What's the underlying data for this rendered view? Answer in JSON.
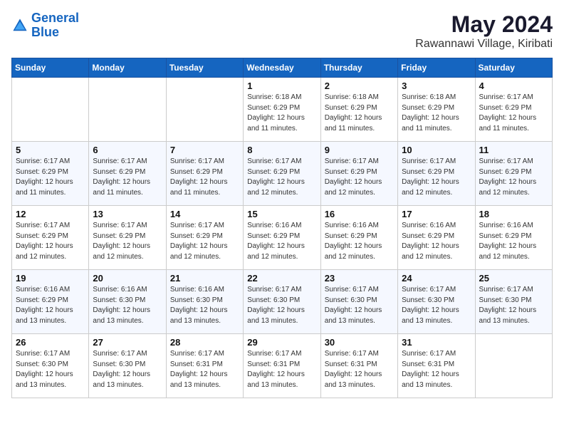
{
  "header": {
    "logo_line1": "General",
    "logo_line2": "Blue",
    "month": "May 2024",
    "location": "Rawannawi Village, Kiribati"
  },
  "weekdays": [
    "Sunday",
    "Monday",
    "Tuesday",
    "Wednesday",
    "Thursday",
    "Friday",
    "Saturday"
  ],
  "weeks": [
    [
      {
        "day": "",
        "info": ""
      },
      {
        "day": "",
        "info": ""
      },
      {
        "day": "",
        "info": ""
      },
      {
        "day": "1",
        "info": "Sunrise: 6:18 AM\nSunset: 6:29 PM\nDaylight: 12 hours\nand 11 minutes."
      },
      {
        "day": "2",
        "info": "Sunrise: 6:18 AM\nSunset: 6:29 PM\nDaylight: 12 hours\nand 11 minutes."
      },
      {
        "day": "3",
        "info": "Sunrise: 6:18 AM\nSunset: 6:29 PM\nDaylight: 12 hours\nand 11 minutes."
      },
      {
        "day": "4",
        "info": "Sunrise: 6:17 AM\nSunset: 6:29 PM\nDaylight: 12 hours\nand 11 minutes."
      }
    ],
    [
      {
        "day": "5",
        "info": "Sunrise: 6:17 AM\nSunset: 6:29 PM\nDaylight: 12 hours\nand 11 minutes."
      },
      {
        "day": "6",
        "info": "Sunrise: 6:17 AM\nSunset: 6:29 PM\nDaylight: 12 hours\nand 11 minutes."
      },
      {
        "day": "7",
        "info": "Sunrise: 6:17 AM\nSunset: 6:29 PM\nDaylight: 12 hours\nand 11 minutes."
      },
      {
        "day": "8",
        "info": "Sunrise: 6:17 AM\nSunset: 6:29 PM\nDaylight: 12 hours\nand 12 minutes."
      },
      {
        "day": "9",
        "info": "Sunrise: 6:17 AM\nSunset: 6:29 PM\nDaylight: 12 hours\nand 12 minutes."
      },
      {
        "day": "10",
        "info": "Sunrise: 6:17 AM\nSunset: 6:29 PM\nDaylight: 12 hours\nand 12 minutes."
      },
      {
        "day": "11",
        "info": "Sunrise: 6:17 AM\nSunset: 6:29 PM\nDaylight: 12 hours\nand 12 minutes."
      }
    ],
    [
      {
        "day": "12",
        "info": "Sunrise: 6:17 AM\nSunset: 6:29 PM\nDaylight: 12 hours\nand 12 minutes."
      },
      {
        "day": "13",
        "info": "Sunrise: 6:17 AM\nSunset: 6:29 PM\nDaylight: 12 hours\nand 12 minutes."
      },
      {
        "day": "14",
        "info": "Sunrise: 6:17 AM\nSunset: 6:29 PM\nDaylight: 12 hours\nand 12 minutes."
      },
      {
        "day": "15",
        "info": "Sunrise: 6:16 AM\nSunset: 6:29 PM\nDaylight: 12 hours\nand 12 minutes."
      },
      {
        "day": "16",
        "info": "Sunrise: 6:16 AM\nSunset: 6:29 PM\nDaylight: 12 hours\nand 12 minutes."
      },
      {
        "day": "17",
        "info": "Sunrise: 6:16 AM\nSunset: 6:29 PM\nDaylight: 12 hours\nand 12 minutes."
      },
      {
        "day": "18",
        "info": "Sunrise: 6:16 AM\nSunset: 6:29 PM\nDaylight: 12 hours\nand 12 minutes."
      }
    ],
    [
      {
        "day": "19",
        "info": "Sunrise: 6:16 AM\nSunset: 6:29 PM\nDaylight: 12 hours\nand 13 minutes."
      },
      {
        "day": "20",
        "info": "Sunrise: 6:16 AM\nSunset: 6:30 PM\nDaylight: 12 hours\nand 13 minutes."
      },
      {
        "day": "21",
        "info": "Sunrise: 6:16 AM\nSunset: 6:30 PM\nDaylight: 12 hours\nand 13 minutes."
      },
      {
        "day": "22",
        "info": "Sunrise: 6:17 AM\nSunset: 6:30 PM\nDaylight: 12 hours\nand 13 minutes."
      },
      {
        "day": "23",
        "info": "Sunrise: 6:17 AM\nSunset: 6:30 PM\nDaylight: 12 hours\nand 13 minutes."
      },
      {
        "day": "24",
        "info": "Sunrise: 6:17 AM\nSunset: 6:30 PM\nDaylight: 12 hours\nand 13 minutes."
      },
      {
        "day": "25",
        "info": "Sunrise: 6:17 AM\nSunset: 6:30 PM\nDaylight: 12 hours\nand 13 minutes."
      }
    ],
    [
      {
        "day": "26",
        "info": "Sunrise: 6:17 AM\nSunset: 6:30 PM\nDaylight: 12 hours\nand 13 minutes."
      },
      {
        "day": "27",
        "info": "Sunrise: 6:17 AM\nSunset: 6:30 PM\nDaylight: 12 hours\nand 13 minutes."
      },
      {
        "day": "28",
        "info": "Sunrise: 6:17 AM\nSunset: 6:31 PM\nDaylight: 12 hours\nand 13 minutes."
      },
      {
        "day": "29",
        "info": "Sunrise: 6:17 AM\nSunset: 6:31 PM\nDaylight: 12 hours\nand 13 minutes."
      },
      {
        "day": "30",
        "info": "Sunrise: 6:17 AM\nSunset: 6:31 PM\nDaylight: 12 hours\nand 13 minutes."
      },
      {
        "day": "31",
        "info": "Sunrise: 6:17 AM\nSunset: 6:31 PM\nDaylight: 12 hours\nand 13 minutes."
      },
      {
        "day": "",
        "info": ""
      }
    ]
  ]
}
